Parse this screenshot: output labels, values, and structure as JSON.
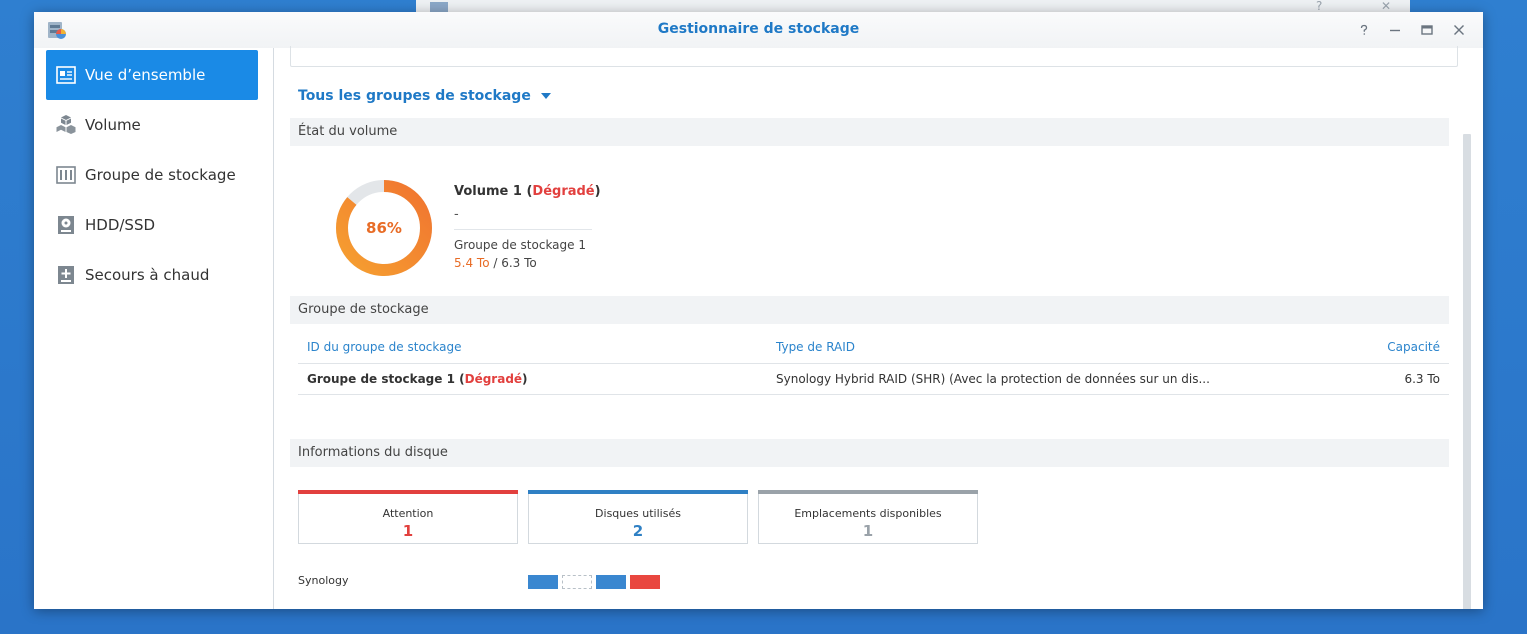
{
  "window": {
    "title": "Gestionnaire de stockage",
    "controls": [
      "?",
      "–",
      "□",
      "✕"
    ]
  },
  "sidebar": {
    "items": [
      {
        "label": "Vue d’ensemble",
        "icon": "overview-icon",
        "active": true
      },
      {
        "label": "Volume",
        "icon": "volume-cubes-icon",
        "active": false
      },
      {
        "label": "Groupe de stockage",
        "icon": "storage-pool-icon",
        "active": false
      },
      {
        "label": "HDD/SSD",
        "icon": "hdd-icon",
        "active": false
      },
      {
        "label": "Secours à chaud",
        "icon": "hot-spare-icon",
        "active": false
      }
    ]
  },
  "main": {
    "group_select": "Tous les groupes de stockage",
    "volume_status": {
      "header": "État du volume",
      "usage_percent": 86,
      "usage_text": "86%",
      "name": "Volume 1",
      "state": "Dégradé",
      "description": "-",
      "pool": "Groupe de stockage 1",
      "used": "5.4 To",
      "total": "6.3 To"
    },
    "storage_group": {
      "header": "Groupe de stockage",
      "columns": [
        "ID du groupe de stockage",
        "Type de RAID",
        "Capacité"
      ],
      "rows": [
        {
          "id": "Groupe de stockage 1",
          "state": "Dégradé",
          "raid": "Synology Hybrid RAID (SHR) (Avec la protection de données sur un dis...",
          "capacity": "6.3 To"
        }
      ]
    },
    "disk_info": {
      "header": "Informations du disque",
      "cards": [
        {
          "label": "Attention",
          "value": "1",
          "color": "#e2403e"
        },
        {
          "label": "Disques utilisés",
          "value": "2",
          "color": "#2f80c4"
        },
        {
          "label": "Emplacements disponibles",
          "value": "1",
          "color": "#9aa2a9"
        }
      ],
      "enclosure": "Synology",
      "slots": [
        "used",
        "empty",
        "used",
        "warning"
      ]
    }
  },
  "colors": {
    "accent": "#1a8ae6",
    "title": "#1f79c6",
    "degraded": "#e2403e",
    "donut_start": "#f6a030",
    "donut_end": "#f07430",
    "slot_used": "#3a87d0",
    "slot_warning": "#e9473f"
  }
}
